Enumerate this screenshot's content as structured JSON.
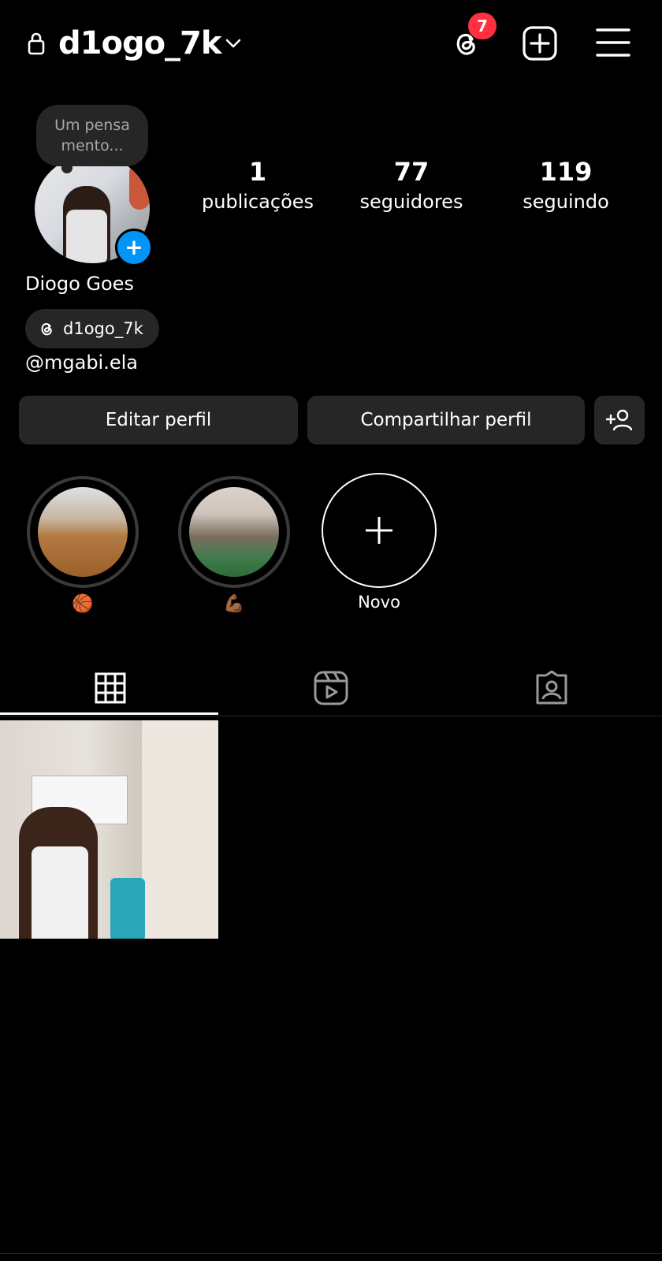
{
  "header": {
    "username": "d1ogo_7k",
    "notification_count": "7"
  },
  "note": {
    "line1": "Um pensa",
    "line2": "mento..."
  },
  "stats": [
    {
      "value": "1",
      "label": "publicações"
    },
    {
      "value": "77",
      "label": "seguidores"
    },
    {
      "value": "119",
      "label": "seguindo"
    }
  ],
  "profile": {
    "full_name": "Diogo Goes",
    "threads_handle": "d1ogo_7k",
    "mention": "@mgabi.ela"
  },
  "buttons": {
    "edit": "Editar perfil",
    "share": "Compartilhar perfil"
  },
  "highlights": [
    {
      "emoji": "🏀"
    },
    {
      "emoji": "💪🏾"
    }
  ],
  "new_highlight_label": "Novo",
  "tabs": [
    "grid",
    "reels",
    "tagged"
  ],
  "colors": {
    "badge": "#ff3040",
    "accent_blue": "#0095f6",
    "button_bg": "#262626"
  }
}
